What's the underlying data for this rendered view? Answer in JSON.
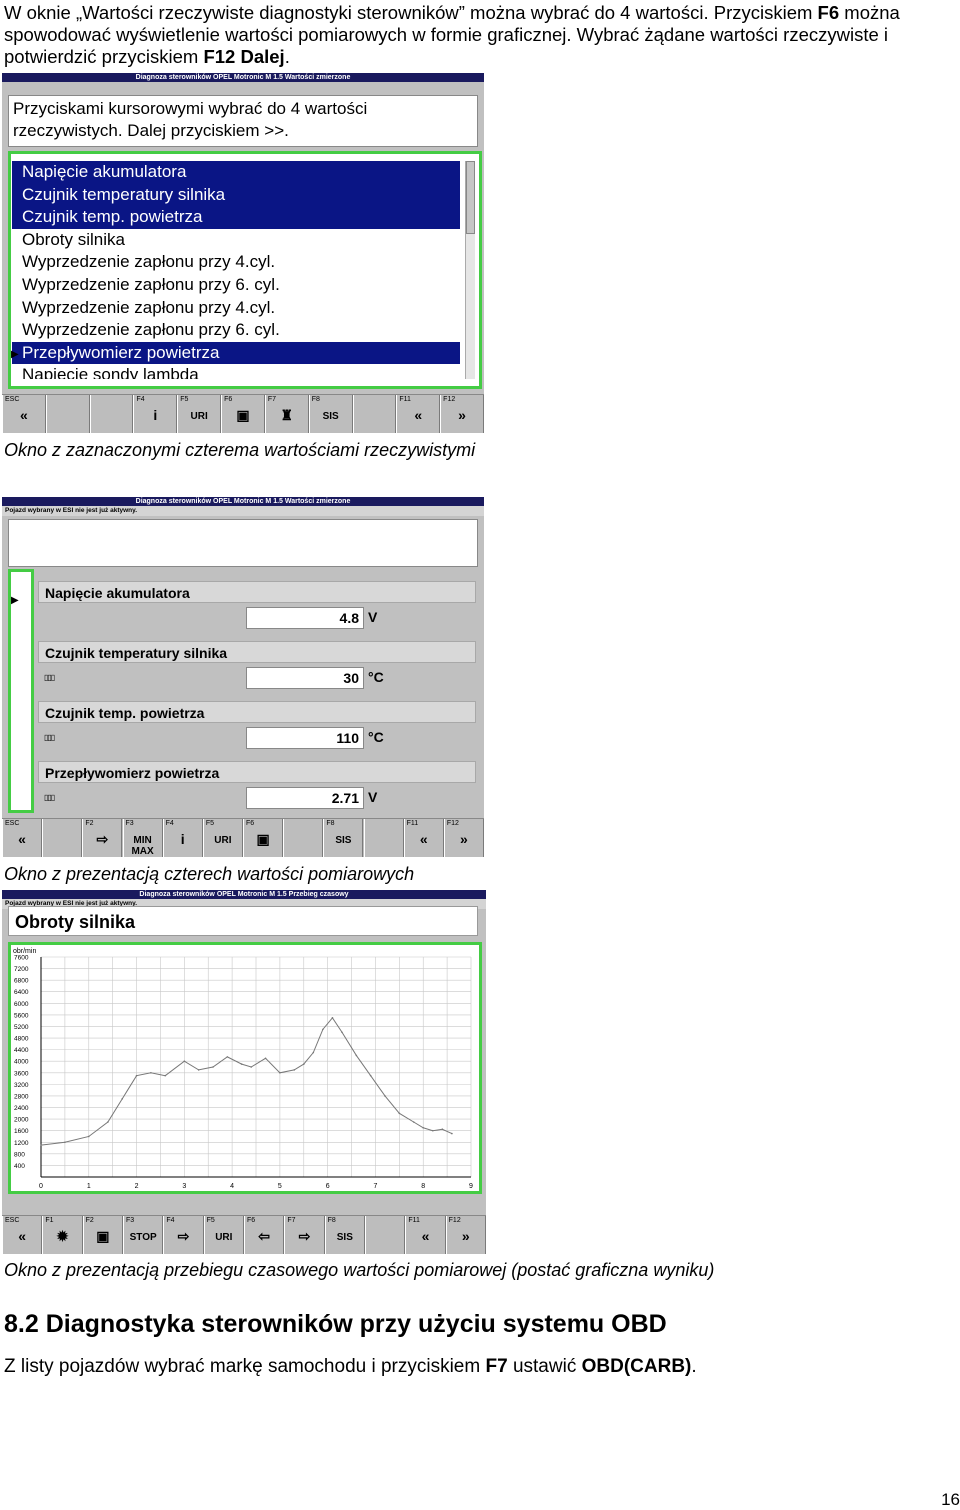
{
  "intro": {
    "line1_a": "W oknie „Wartości rzeczywiste diagnostyki sterowników” można wybrać do 4 wartości. Przyciskiem ",
    "line1_key": "F6",
    "line2": " można spowodować wyświetlenie wartości pomiarowych w formie graficznej. Wybrać żądane wartości rzeczywiste i potwierdzić przyciskiem ",
    "line2_key": "F12 Dalej",
    "line2_end": "."
  },
  "screen1": {
    "title": "Diagnoza sterowników   OPEL   Motronic M 1.5   Wartości zmierzone",
    "instruction": "Przyciskami kursorowymi wybrać do 4 wartości rzeczywistych. Dalej przyciskiem >>.",
    "items": [
      {
        "label": "Napięcie akumulatora",
        "selected": true
      },
      {
        "label": "Czujnik temperatury silnika",
        "selected": true
      },
      {
        "label": "Czujnik temp. powietrza",
        "selected": true
      },
      {
        "label": "Obroty silnika",
        "selected": false
      },
      {
        "label": "Wyprzedzenie zapłonu przy 4.cyl.",
        "selected": false
      },
      {
        "label": "Wyprzedzenie zapłonu przy 6. cyl.",
        "selected": false
      },
      {
        "label": "Wyprzedzenie zapłonu przy 4.cyl.",
        "selected": false
      },
      {
        "label": "Wyprzedzenie zapłonu przy 6. cyl.",
        "selected": false
      },
      {
        "label": "Przepływomierz powietrza",
        "selected": true
      },
      {
        "label": "Napięcie sondy lambda",
        "selected": false
      }
    ],
    "fkeys": [
      {
        "key": "ESC",
        "icon": "«"
      },
      {
        "key": "",
        "icon": ""
      },
      {
        "key": "",
        "icon": ""
      },
      {
        "key": "F4",
        "icon": "i"
      },
      {
        "key": "F5",
        "icon": "URI"
      },
      {
        "key": "F6",
        "icon": "▣"
      },
      {
        "key": "F7",
        "icon": "♜"
      },
      {
        "key": "F8",
        "icon": "SIS"
      },
      {
        "key": "",
        "icon": ""
      },
      {
        "key": "F11",
        "icon": "«"
      },
      {
        "key": "F12",
        "icon": "»"
      }
    ]
  },
  "caption1": "Okno z zaznaczonymi czterema wartościami rzeczywistymi",
  "screen2": {
    "title": "Diagnoza sterowników   OPEL   Motronic M 1.5   Wartości zmierzone",
    "subtitle": "Pojazd wybrany w ESI nie jest już aktywny.",
    "values": [
      {
        "name": "Napięcie akumulatora",
        "value": "4.8",
        "unit": "V"
      },
      {
        "name": "Czujnik temperatury silnika",
        "value": "30",
        "unit": "°C"
      },
      {
        "name": "Czujnik temp. powietrza",
        "value": "110",
        "unit": "°C"
      },
      {
        "name": "Przepływomierz powietrza",
        "value": "2.71",
        "unit": "V"
      }
    ],
    "fkeys": [
      {
        "key": "ESC",
        "icon": "«"
      },
      {
        "key": "",
        "icon": ""
      },
      {
        "key": "F2",
        "icon": "⇨"
      },
      {
        "key": "F3",
        "icon": "MIN MAX"
      },
      {
        "key": "F4",
        "icon": "i"
      },
      {
        "key": "F5",
        "icon": "URI"
      },
      {
        "key": "F6",
        "icon": "▣"
      },
      {
        "key": "",
        "icon": ""
      },
      {
        "key": "F8",
        "icon": "SIS"
      },
      {
        "key": "",
        "icon": ""
      },
      {
        "key": "F11",
        "icon": "«"
      },
      {
        "key": "F12",
        "icon": "»"
      }
    ]
  },
  "caption2": "Okno z prezentacją czterech wartości pomiarowych",
  "screen3": {
    "title": "Diagnoza sterowników   OPEL   Motronic M 1.5   Przebieg czasowy",
    "subtitle": "Pojazd wybrany w ESI nie jest już aktywny.",
    "chart_heading": "Obroty silnika",
    "fkeys": [
      {
        "key": "ESC",
        "icon": "«"
      },
      {
        "key": "F1",
        "icon": "✹"
      },
      {
        "key": "F2",
        "icon": "▣"
      },
      {
        "key": "F3",
        "icon": "STOP"
      },
      {
        "key": "F4",
        "icon": "⇨"
      },
      {
        "key": "F5",
        "icon": "URI"
      },
      {
        "key": "F6",
        "icon": "⇦"
      },
      {
        "key": "F7",
        "icon": "⇨"
      },
      {
        "key": "F8",
        "icon": "SIS"
      },
      {
        "key": "",
        "icon": ""
      },
      {
        "key": "F11",
        "icon": "«"
      },
      {
        "key": "F12",
        "icon": "»"
      }
    ]
  },
  "chart_data": {
    "type": "line",
    "title": "",
    "ylabel": "obr/min",
    "xlabel": "",
    "xlim": [
      0,
      9
    ],
    "ylim": [
      0,
      7600
    ],
    "xticks": [
      "0",
      "1",
      "2",
      "3",
      "4",
      "5",
      "6",
      "7",
      "8",
      "9"
    ],
    "yticks": [
      "7600",
      "7200",
      "6800",
      "6400",
      "6000",
      "5600",
      "5200",
      "4800",
      "4400",
      "4000",
      "3600",
      "3200",
      "2800",
      "2400",
      "2000",
      "1600",
      "1200",
      "800",
      "400"
    ],
    "grid": true,
    "series": [
      {
        "x": [
          0.0,
          0.5,
          1.0,
          1.4,
          1.7,
          2.0,
          2.3,
          2.6,
          3.0,
          3.3,
          3.6,
          3.9,
          4.2,
          4.4,
          4.7,
          5.0,
          5.3,
          5.5,
          5.7,
          5.9,
          6.1,
          6.3,
          6.6,
          6.9,
          7.2,
          7.5,
          7.8,
          8.0,
          8.2,
          8.4,
          8.6
        ],
        "y": [
          1100,
          1200,
          1400,
          1900,
          2700,
          3500,
          3600,
          3500,
          4000,
          3700,
          3800,
          4150,
          3900,
          3800,
          4100,
          3600,
          3700,
          3900,
          4300,
          5100,
          5500,
          5000,
          4200,
          3500,
          2800,
          2200,
          1900,
          1700,
          1600,
          1650,
          1500
        ]
      }
    ]
  },
  "caption3": "Okno z prezentacją przebiegu czasowego wartości pomiarowej (postać graficzna wyniku)",
  "section": {
    "heading": "8.2  Diagnostyka sterowników przy użyciu systemu OBD",
    "text_a": "Z listy pojazdów wybrać markę samochodu i przyciskiem ",
    "text_key": "F7",
    "text_b": " ustawić ",
    "text_obd": "OBD(CARB)",
    "text_end": "."
  },
  "page_number": "16"
}
